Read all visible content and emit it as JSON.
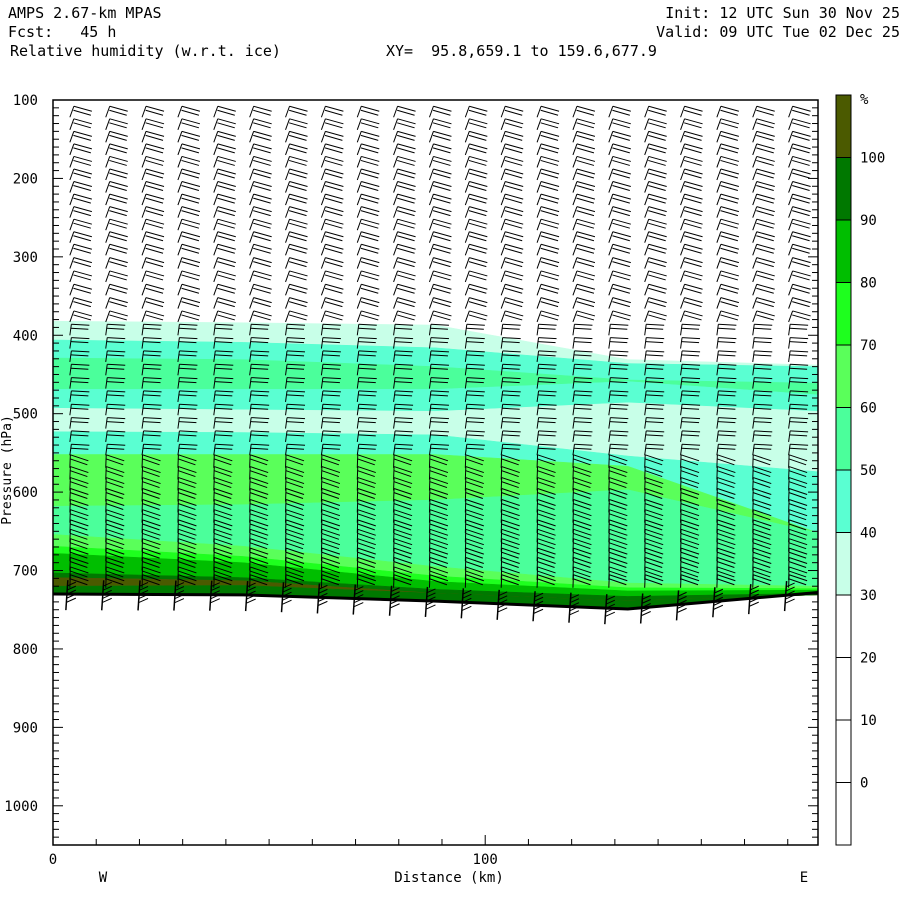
{
  "header": {
    "model": "AMPS 2.67-km MPAS",
    "forecast": "Fcst:   45 h",
    "field": "Relative humidity (w.r.t. ice)",
    "xy": "XY=  95.8,659.1 to 159.6,677.9",
    "init": "Init: 12 UTC Sun 30 Nov 25",
    "valid": "Valid: 09 UTC Tue 02 Dec 25"
  },
  "chart_data": {
    "type": "heatmap",
    "title": "Relative humidity (w.r.t. ice)",
    "xlabel": "Distance (km)",
    "ylabel": "Pressure (hPa)",
    "xlim": [
      0,
      177
    ],
    "ylim": [
      1050,
      100
    ],
    "x_ticks": [
      "0",
      "100"
    ],
    "x_tick_values": [
      0,
      100
    ],
    "y_ticks": [
      "100",
      "200",
      "300",
      "400",
      "500",
      "600",
      "700",
      "800",
      "900",
      "1000"
    ],
    "y_tick_values": [
      100,
      200,
      300,
      400,
      500,
      600,
      700,
      800,
      900,
      1000
    ],
    "left_label": "W",
    "right_label": "E",
    "colorbar": {
      "unit": "%",
      "labels": [
        "100",
        "90",
        "80",
        "70",
        "60",
        "50",
        "40",
        "30",
        "20",
        "10",
        "0"
      ],
      "levels": [
        {
          "range": ">100",
          "color": "#4b5a00"
        },
        {
          "range": "90-100",
          "color": "#007800"
        },
        {
          "range": "80-90",
          "color": "#00be00"
        },
        {
          "range": "70-80",
          "color": "#1eff1e"
        },
        {
          "range": "60-70",
          "color": "#5aff5a"
        },
        {
          "range": "50-60",
          "color": "#4bff9b"
        },
        {
          "range": "40-50",
          "color": "#5affd2"
        },
        {
          "range": "30-40",
          "color": "#c8ffe8"
        },
        {
          "range": "20-30",
          "color": "#ffffff"
        },
        {
          "range": "10-20",
          "color": "#ffffff"
        },
        {
          "range": "0-10",
          "color": "#ffffff"
        },
        {
          "range": "<0",
          "color": "#ffffff"
        }
      ]
    },
    "section_x_km": [
      0,
      44,
      88.5,
      133,
      177
    ],
    "bands": [
      {
        "level": "20-30",
        "bottom_hPa": [
          382,
          384,
          387,
          431,
          438
        ]
      },
      {
        "level": "30-40",
        "bottom_hPa": [
          406,
          409,
          416,
          436,
          440
        ]
      },
      {
        "level": "40-50",
        "bottom_hPa": [
          429,
          431,
          440,
          457,
          461
        ]
      },
      {
        "level": "50-60",
        "bottom_hPa": [
          469,
          469,
          469,
          459,
          476
        ]
      },
      {
        "level": "40-50",
        "bottom_hPa": [
          493,
          495,
          497,
          486,
          497
        ]
      },
      {
        "level": "30-40",
        "bottom_hPa": [
          523,
          524,
          527,
          554,
          574
        ]
      },
      {
        "level": "40-50",
        "bottom_hPa": [
          552,
          552,
          552,
          567,
          652
        ]
      },
      {
        "level": "60-70",
        "bottom_hPa": [
          618,
          616,
          610,
          597,
          652
        ]
      },
      {
        "level": "50-60",
        "bottom_hPa": [
          654,
          669,
          695,
          716,
          720
        ]
      },
      {
        "level": "60-70",
        "bottom_hPa": [
          669,
          682,
          707,
          722,
          723
        ]
      },
      {
        "level": "70-80",
        "bottom_hPa": [
          678,
          690,
          714,
          726,
          725
        ]
      },
      {
        "level": "80-90",
        "bottom_hPa": [
          703,
          709,
          724,
          733,
          729
        ]
      },
      {
        "level": "90-100",
        "bottom_hPa": [
          709,
          713,
          729,
          739,
          731
        ]
      },
      {
        "level": ">100",
        "bottom_hPa": [
          720,
          719,
          729,
          739,
          731
        ]
      },
      {
        "level": "90-100",
        "bottom_hPa": [
          730,
          731,
          739,
          749,
          728
        ]
      }
    ],
    "terrain_hPa": [
      730,
      731,
      739,
      749,
      728
    ],
    "wind_columns_km": [
      3.9,
      12.2,
      20.6,
      28.9,
      37.2,
      45.5,
      53.8,
      62.1,
      70.4,
      78.8,
      87.1,
      95.4,
      103.7,
      112.0,
      120.3,
      128.6,
      136.9,
      145.2,
      153.6,
      161.9,
      170.2
    ],
    "wind_levels_hPa": [
      122,
      138,
      154,
      170,
      186,
      202,
      218,
      234,
      250,
      266,
      282,
      298,
      315,
      332,
      349,
      366,
      383,
      400,
      417,
      434,
      451,
      468,
      485,
      502,
      519,
      536,
      553,
      569,
      584,
      598,
      612,
      626,
      639,
      652,
      664,
      676,
      688,
      700,
      712,
      722
    ]
  }
}
